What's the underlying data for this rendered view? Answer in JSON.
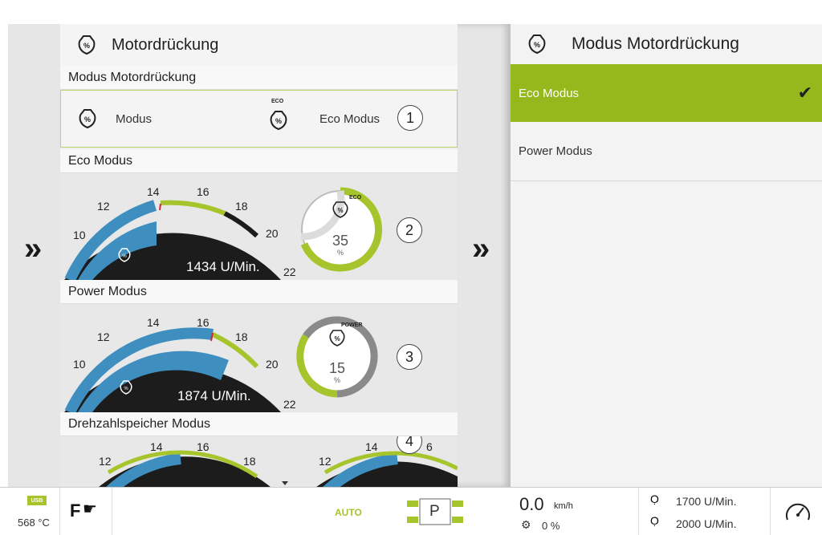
{
  "left_panel": {
    "title": "Motordrückung",
    "current_section": "Modus Motordrückung",
    "modus_label": "Modus",
    "eco_badge": "ECO",
    "selected_mode": "Eco Modus",
    "callouts": [
      "1",
      "2",
      "3",
      "4"
    ]
  },
  "eco_section": {
    "label": "Eco Modus",
    "ticks": [
      "10",
      "12",
      "14",
      "16",
      "18",
      "20",
      "22"
    ],
    "rpm": "1434 U/Min.",
    "badge": "ECO",
    "percent": "35",
    "percent_unit": "%",
    "level": 0.35
  },
  "power_section": {
    "label": "Power Modus",
    "ticks": [
      "10",
      "12",
      "14",
      "16",
      "18",
      "20",
      "22"
    ],
    "rpm": "1874 U/Min.",
    "badge": "POWER",
    "percent": "15",
    "percent_unit": "%",
    "level": 0.15
  },
  "speicher_section": {
    "label": "Drehzahlspeicher Modus",
    "ticks_a": [
      "12",
      "14",
      "16",
      "18"
    ],
    "ticks_b": [
      "12",
      "14",
      "6"
    ]
  },
  "right_panel": {
    "title": "Modus Motordrückung",
    "options": [
      {
        "label": "Eco Modus",
        "selected": true
      },
      {
        "label": "Power Modus",
        "selected": false
      }
    ]
  },
  "bottom_bar": {
    "usb_label": "USB",
    "temperature": "568 °C",
    "f_label": "F",
    "auto_label": "AUTO",
    "gear": "P",
    "speed_value": "0.0",
    "speed_unit": "km/h",
    "slip_value": "0 %",
    "rpm_1": "1700 U/Min.",
    "rpm_2": "2000 U/Min."
  },
  "colors": {
    "accent_green": "#95b81d",
    "gauge_blue": "#3e8fc0",
    "gauge_dark": "#1c1c1c"
  }
}
